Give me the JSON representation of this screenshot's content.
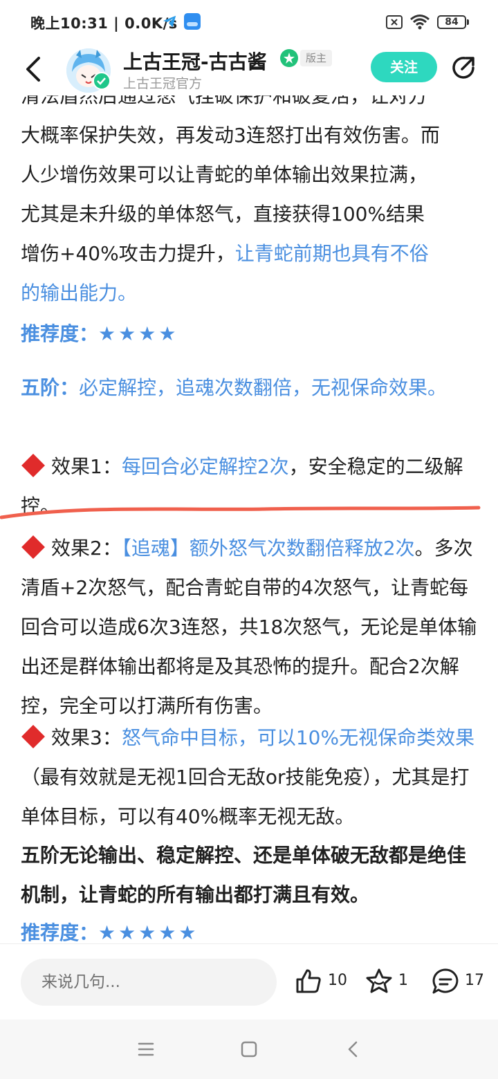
{
  "status_bar": {
    "time_speed": "晚上10:31 | 0.0K/s",
    "battery": "84",
    "icons": [
      "telegram-icon",
      "app-notification-icon",
      "sim-off-icon",
      "wifi-icon",
      "battery-icon"
    ]
  },
  "header": {
    "author_name": "上古王冠-古古酱",
    "moderator_tag": "版主",
    "author_subtitle": "上古王冠官方",
    "follow_label": "关注",
    "accent_color": "#2ed8bf"
  },
  "article": {
    "p_top": {
      "l1": "清法盾然后通过怒气挂破保护和破复活，让对方",
      "l2": "大概率保护失效，再发动3连怒打出有效伤害。而",
      "l3": "人少增伤效果可以让青蛇的单体输出效果拉满，",
      "l4": "尤其是未升级的单体怒气，直接获得100%结果",
      "l5a": "增伤+40%攻击力提升，",
      "l5b": "让青蛇前期也具有不俗",
      "l6": "的输出能力。"
    },
    "rec1_label": "推荐度：",
    "rec1_stars": "★★★★",
    "tier5_label": "五阶：",
    "tier5_text": "必定解控，追魂次数翻倍，无视保命效果。",
    "eff1_label": "效果1：",
    "eff1_blue": "每回合必定解控2次",
    "eff1_rest": "，安全稳定的二级解控。",
    "eff2_label": "效果2：",
    "eff2_blue": "【追魂】额外怒气次数翻倍释放2次",
    "eff2_rest": "。多次清盾+2次怒气，配合青蛇自带的4次怒气，让青蛇每回合可以造成6次3连怒，共18次怒气，无论是单体输出还是群体输出都将是及其恐怖的提升。配合2次解控，完全可以打满所有伤害。",
    "eff3_label": "效果3：",
    "eff3_blue": "怒气命中目标，可以10%无视保命类效果",
    "eff3_rest": "（最有效就是无视1回合无敌or技能免疫），尤其是打单体目标，可以有40%概率无视无敌。",
    "summary": "五阶无论输出、稳定解控、还是单体破无敌都是绝佳机制，让青蛇的所有输出都打满且有效。",
    "rec2_label": "推荐度：",
    "rec2_stars": "★★★★★",
    "link_color": "#4a8fe0",
    "underline_color": "#f0604d"
  },
  "bottom_bar": {
    "comment_placeholder": "来说几句...",
    "like_count": "10",
    "favorite_count": "1",
    "comment_count": "17"
  },
  "nav_bar": {
    "items": [
      "menu-icon",
      "home-icon",
      "back-icon"
    ]
  }
}
